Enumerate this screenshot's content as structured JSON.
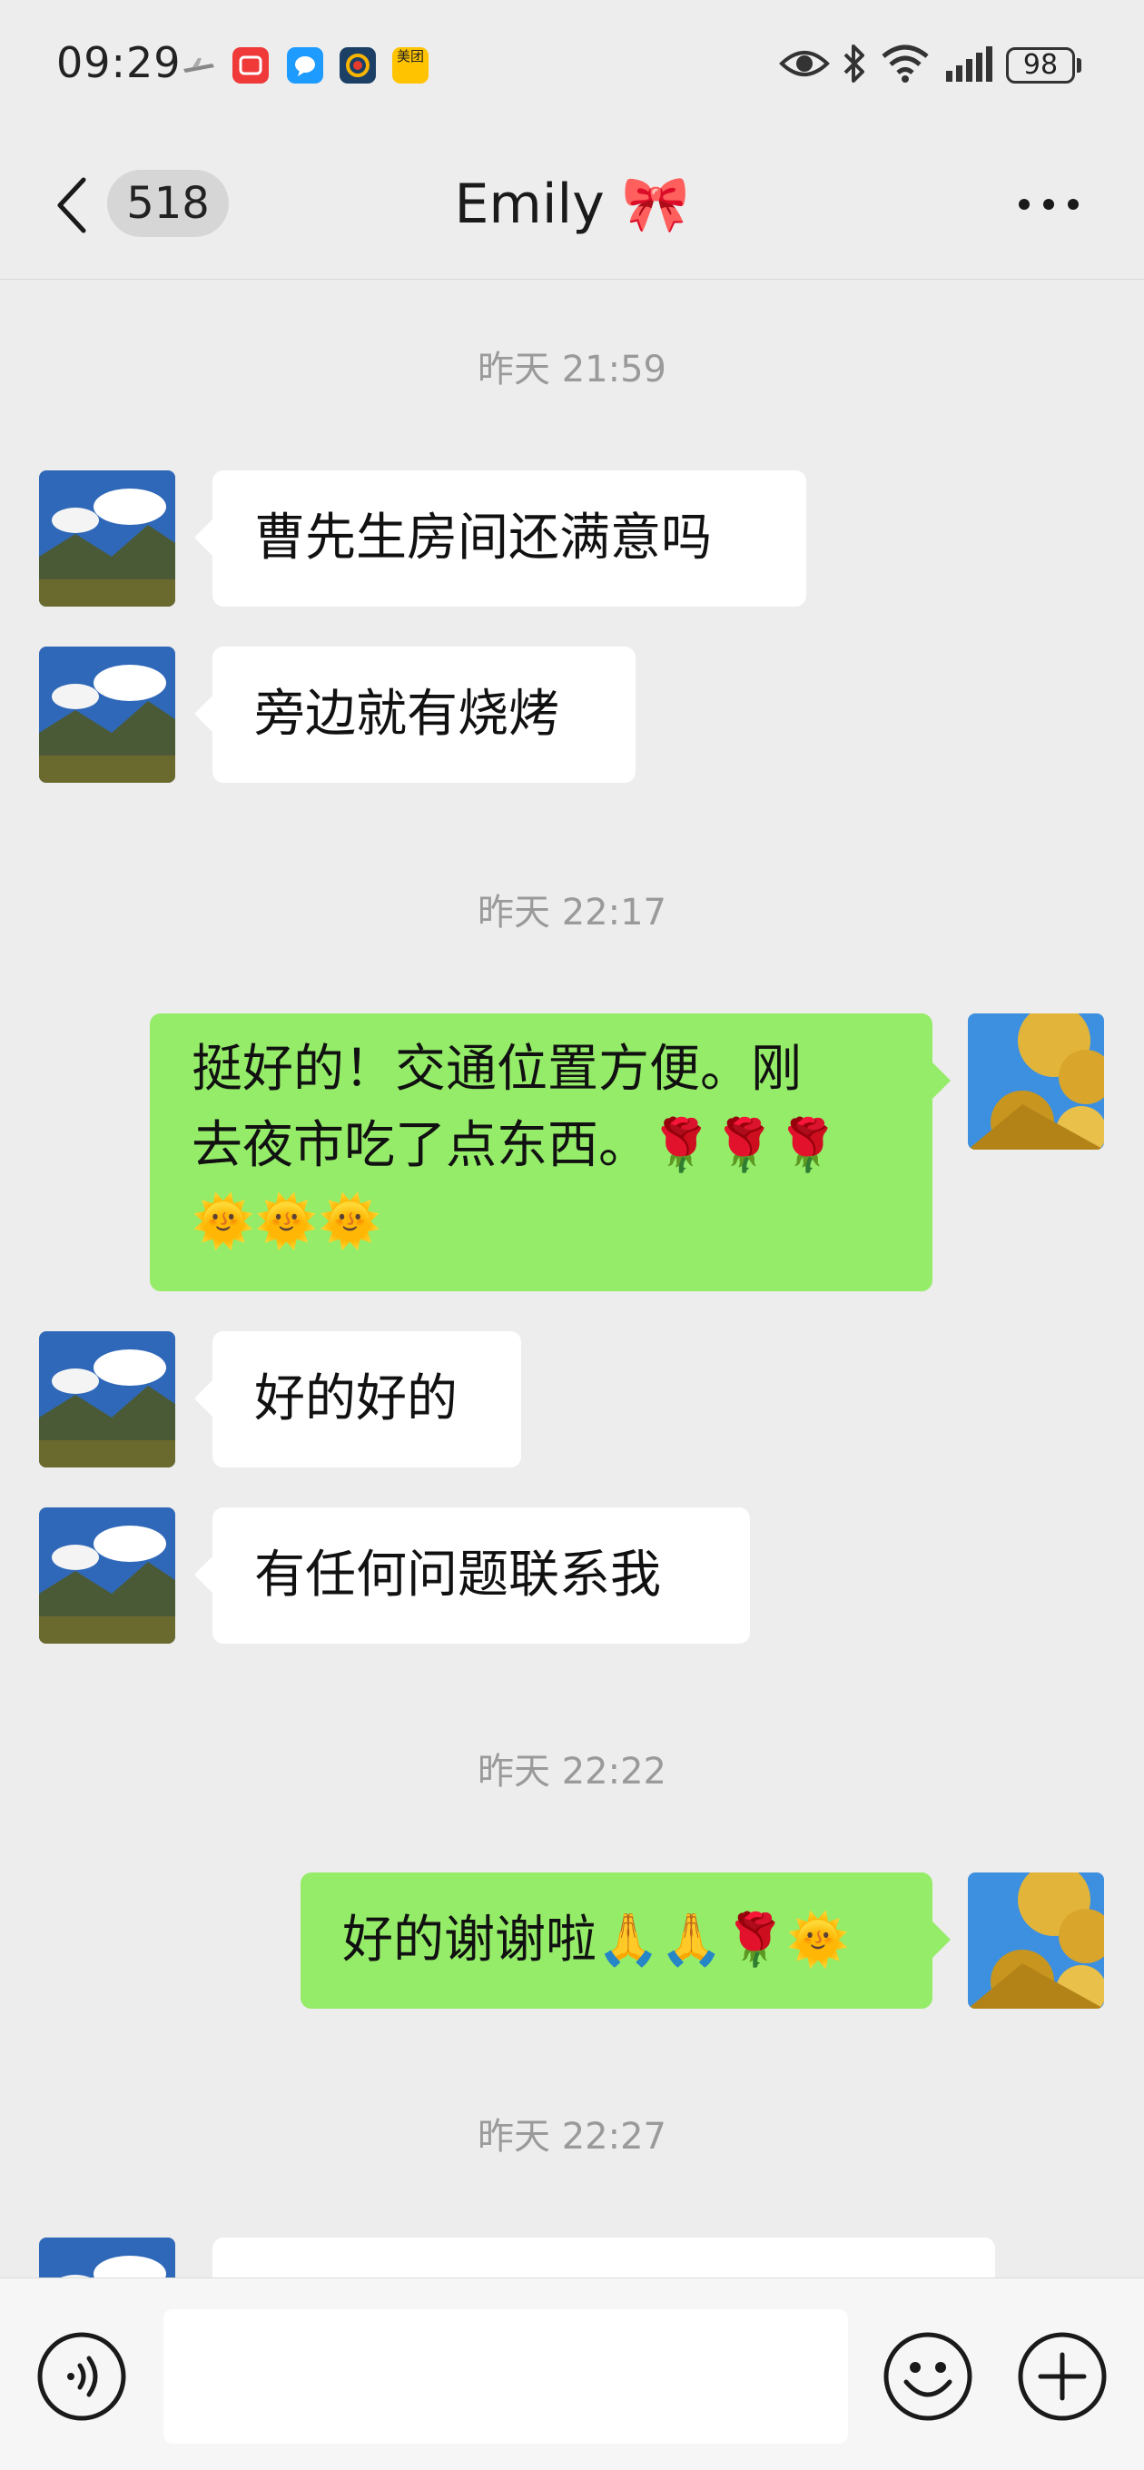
{
  "status_bar": {
    "time": "09:29",
    "battery": "98",
    "app_icons": [
      "plane-icon",
      "red-app-icon",
      "chat-app-icon",
      "colorful-app-icon",
      "meituan-icon"
    ],
    "meituan_label": "美团",
    "right_icons": [
      "eye-icon",
      "bluetooth-icon",
      "wifi-icon",
      "signal-icon"
    ]
  },
  "nav": {
    "unread_count": "518",
    "title": "Emily 🎀"
  },
  "messages": [
    {
      "type": "time",
      "text": "昨天 21:59"
    },
    {
      "type": "in",
      "text": "曹先生房间还满意吗"
    },
    {
      "type": "in",
      "text": "旁边就有烧烤"
    },
    {
      "type": "time",
      "text": "昨天 22:17"
    },
    {
      "type": "out",
      "line1": "挺好的！交通位置方便。刚",
      "line2": "去夜市吃了点东西。🌹🌹🌹",
      "line3": "🌞🌞🌞"
    },
    {
      "type": "in",
      "text": "好的好的"
    },
    {
      "type": "in",
      "text": "有任何问题联系我"
    },
    {
      "type": "time",
      "text": "昨天 22:22"
    },
    {
      "type": "out",
      "text": "好的谢谢啦🙏🙏🌹🌞"
    },
    {
      "type": "time",
      "text": "昨天 22:27"
    }
  ],
  "input_bar": {
    "icons": [
      "voice-icon",
      "emoji-icon",
      "plus-icon"
    ],
    "placeholder": ""
  },
  "colors": {
    "background": "#ededed",
    "incoming_bubble": "#ffffff",
    "outgoing_bubble": "#95ec69",
    "timestamp": "#9a9a9a"
  }
}
